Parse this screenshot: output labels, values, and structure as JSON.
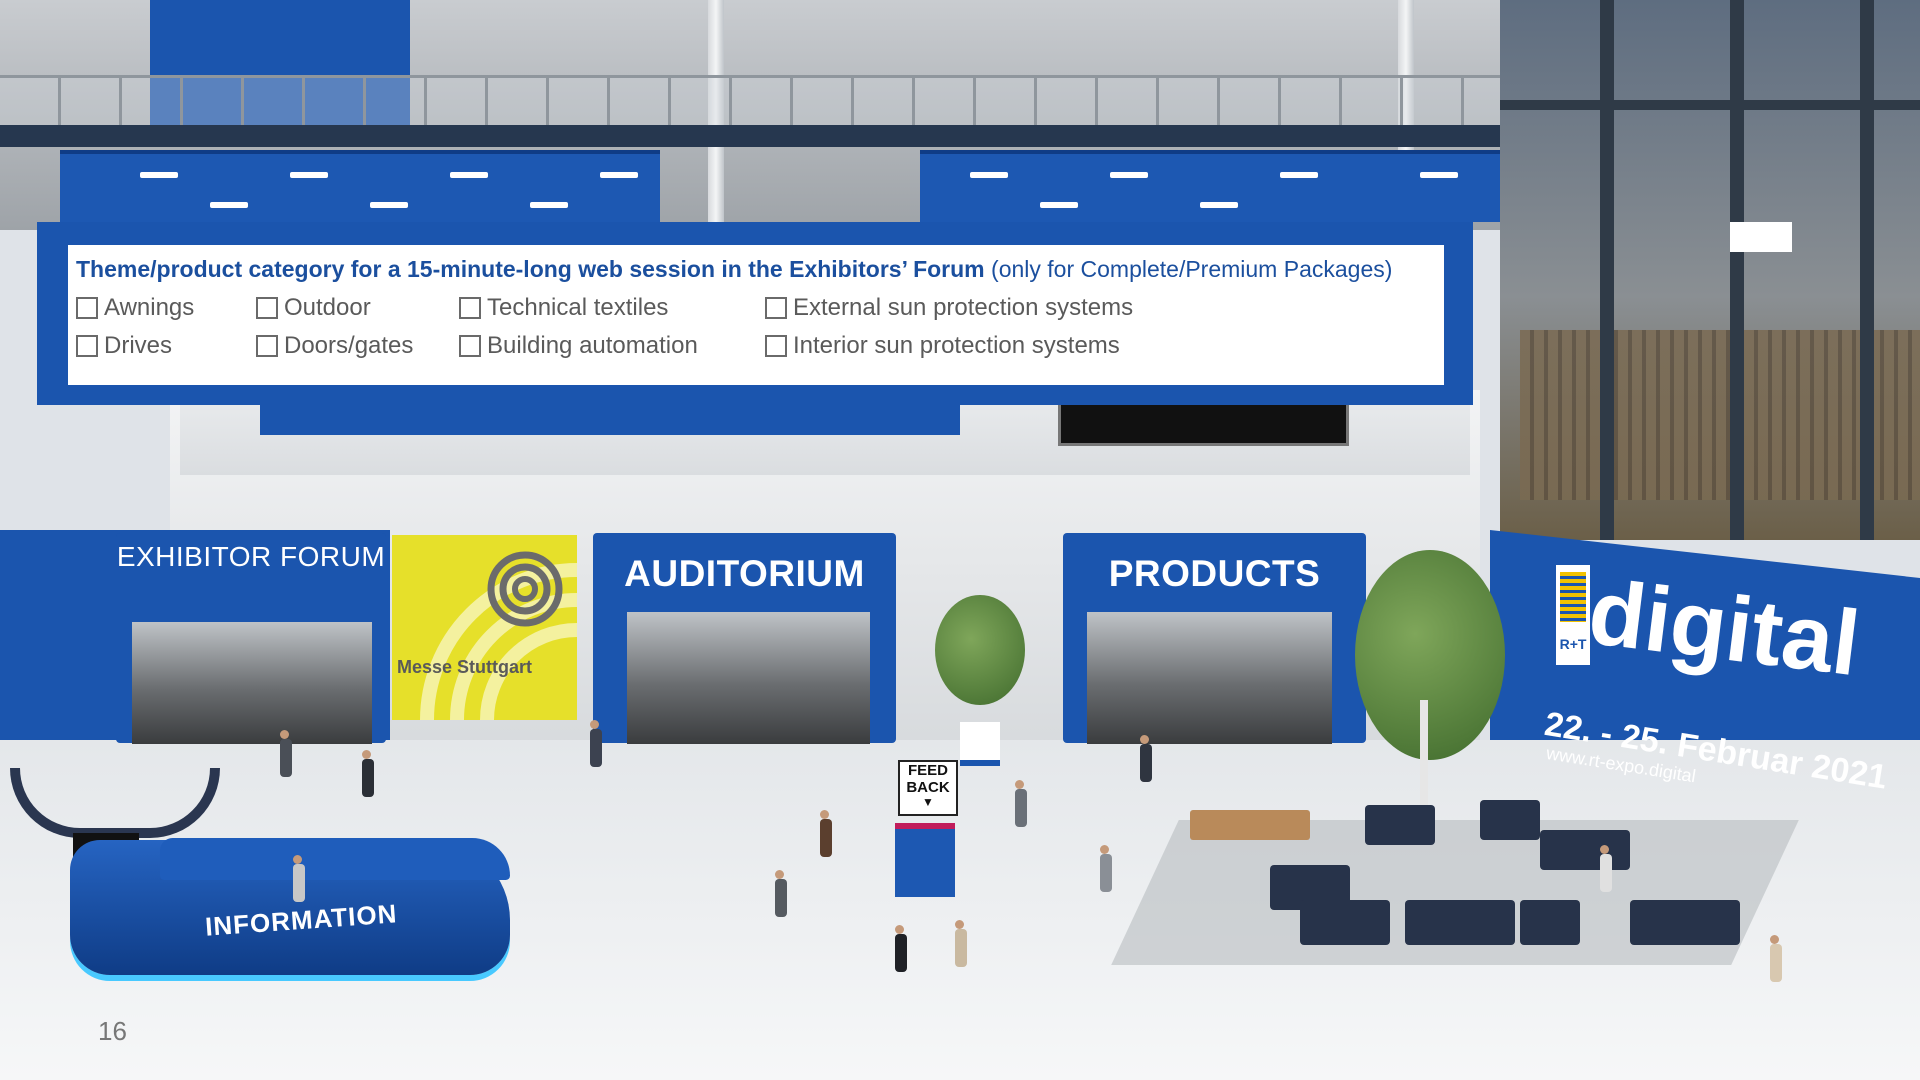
{
  "form": {
    "title_bold": "Theme/product category for a 15-minute-long web session in the Exhibitors’ Forum",
    "title_note": "(only for Complete/Premium Packages)",
    "options": [
      "Awnings",
      "Outdoor",
      "Technical textiles",
      "External sun protection systems",
      "Drives",
      "Doors/gates",
      "Building automation",
      "Interior sun protection systems"
    ]
  },
  "hall": {
    "exhibitor_forum": "EXHIBITOR FORUM",
    "auditorium": "AUDITORIUM",
    "products": "PRODUCTS",
    "information": "INFORMATION",
    "feedback_line1": "FEED",
    "feedback_line2": "BACK",
    "messe": "Messe Stuttgart"
  },
  "event": {
    "logo_text": "R+T",
    "brand": "digital",
    "dates": "22. - 25. Februar 2021",
    "url": "www.rt-expo.digital"
  },
  "slide": {
    "page_number": "16"
  },
  "colors": {
    "brand_blue": "#1b55ae",
    "title_blue": "#1b4f9e",
    "messe_yellow": "#e6e02a"
  }
}
